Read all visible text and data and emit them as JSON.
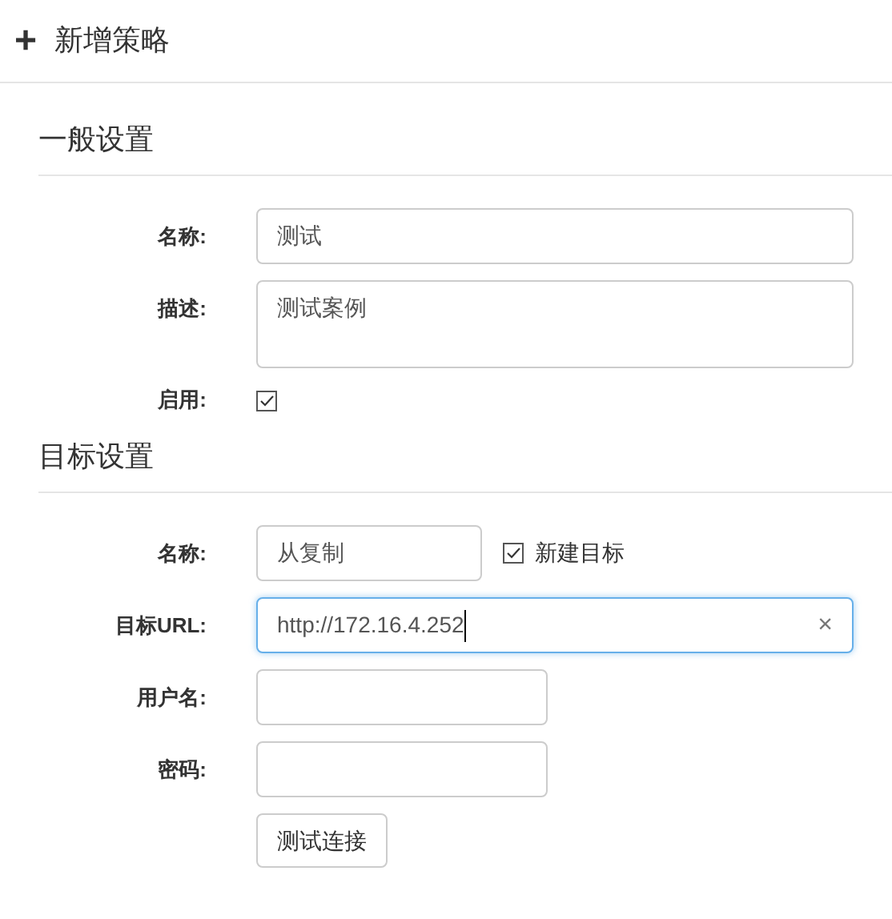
{
  "header": {
    "icon": "+",
    "title": "新增策略"
  },
  "sections": [
    {
      "title": "一般设置",
      "rows": [
        {
          "kind": "text",
          "label": "名称:",
          "value": "测试",
          "focused": false
        },
        {
          "kind": "textarea",
          "label": "描述:",
          "value": "测试案例"
        },
        {
          "kind": "checkbox",
          "label": "启用:",
          "checked": true
        }
      ]
    },
    {
      "title": "目标设置",
      "rows": [
        {
          "kind": "short_text",
          "label": "名称:",
          "value": "从复制",
          "focused": false,
          "option": {
            "label": "新建目标",
            "checked": true
          }
        },
        {
          "kind": "text",
          "label": "目标URL:",
          "value": "http://172.16.4.252",
          "focused": true,
          "clear": "×"
        },
        {
          "kind": "medium_text",
          "label": "用户名:",
          "value": "",
          "focused": false
        },
        {
          "kind": "medium_text",
          "label": "密码:",
          "value": "",
          "focused": false
        },
        {
          "kind": "button",
          "label": "测试连接"
        }
      ]
    }
  ]
}
